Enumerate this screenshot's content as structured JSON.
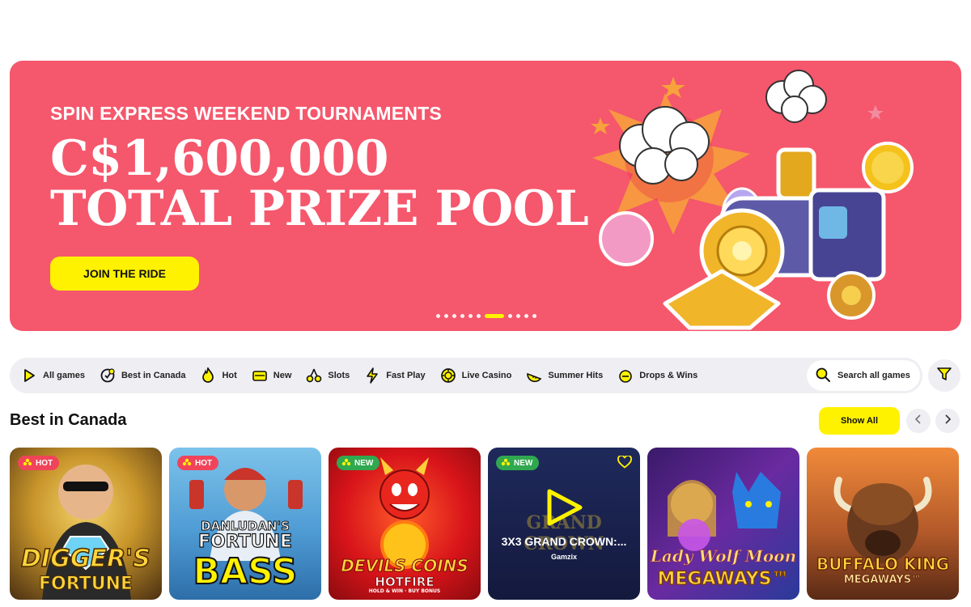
{
  "hero": {
    "subtitle": "SPIN EXPRESS WEEKEND TOURNAMENTS",
    "title_line1": "C$1,600,000",
    "title_line2": "TOTAL PRIZE POOL",
    "cta_label": "JOIN THE RIDE",
    "slide_count": 11,
    "active_slide": 6,
    "bg_color": "#f5576c",
    "cta_color": "#fff200"
  },
  "categories": [
    {
      "label": "All games",
      "icon": "play-icon"
    },
    {
      "label": "Best in Canada",
      "icon": "leaf-badge-icon"
    },
    {
      "label": "Hot",
      "icon": "flame-icon"
    },
    {
      "label": "New",
      "icon": "new-tag-icon"
    },
    {
      "label": "Slots",
      "icon": "cherries-icon"
    },
    {
      "label": "Fast Play",
      "icon": "lightning-icon"
    },
    {
      "label": "Live Casino",
      "icon": "poker-chip-icon"
    },
    {
      "label": "Summer Hits",
      "icon": "watermelon-icon"
    },
    {
      "label": "Drops & Wins",
      "icon": "drops-wins-icon"
    }
  ],
  "search": {
    "label": "Search all games",
    "icon": "search-icon"
  },
  "filter": {
    "icon": "funnel-icon"
  },
  "section": {
    "title": "Best in Canada",
    "show_all_label": "Show All"
  },
  "games": [
    {
      "badge": "HOT",
      "badge_type": "hot",
      "art_title_1": "DIGGER'S",
      "art_title_2": "FORTUNE"
    },
    {
      "badge": "HOT",
      "badge_type": "hot",
      "art_title_1": "DANLUDAN'S",
      "art_title_2": "FORTUNE",
      "art_title_3": "BASS"
    },
    {
      "badge": "NEW",
      "badge_type": "new",
      "art_title_1": "DEVILS COINS",
      "art_title_2": "HOTFIRE",
      "art_title_3": "HOLD & WIN · BUY BONUS"
    },
    {
      "badge": "NEW",
      "badge_type": "new",
      "hover_title": "3X3 GRAND CROWN:...",
      "provider": "Gamzix",
      "art_title_1": "GRAND CROWN"
    },
    {
      "art_title_1": "Lady Wolf Moon",
      "art_title_2": "MEGAWAYS™"
    },
    {
      "art_title_1": "BUFFALO KING",
      "art_title_2": "MEGAWAYS™"
    }
  ]
}
